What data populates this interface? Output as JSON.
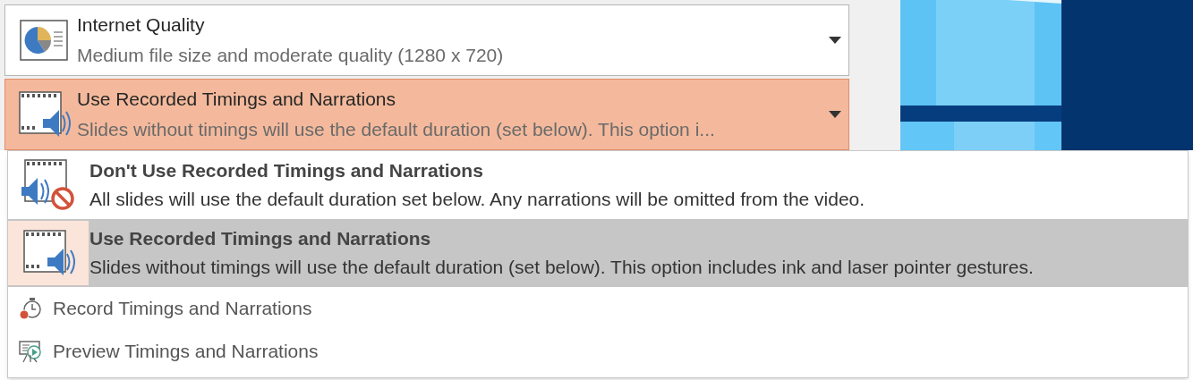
{
  "quality": {
    "title": "Internet Quality",
    "description": "Medium file size and moderate quality (1280 x 720)",
    "highlighted": false
  },
  "timings": {
    "title": "Use Recorded Timings and Narrations",
    "description": "Slides without timings will use the default duration (set below). This option i...",
    "highlighted": true
  },
  "menu": {
    "items": [
      {
        "kind": "mute",
        "title": "Don't Use Recorded Timings and Narrations",
        "description": "All slides will use the default duration set below. Any narrations will be omitted from the video.",
        "selected": false
      },
      {
        "kind": "narrate",
        "title": "Use Recorded Timings and Narrations",
        "description": "Slides without timings will use the default duration (set below). This option includes ink and laser pointer gestures.",
        "selected": true
      },
      {
        "kind": "record",
        "title": "Record Timings and Narrations",
        "selected": false
      },
      {
        "kind": "preview",
        "title": "Preview Timings and Narrations",
        "selected": false
      }
    ]
  }
}
